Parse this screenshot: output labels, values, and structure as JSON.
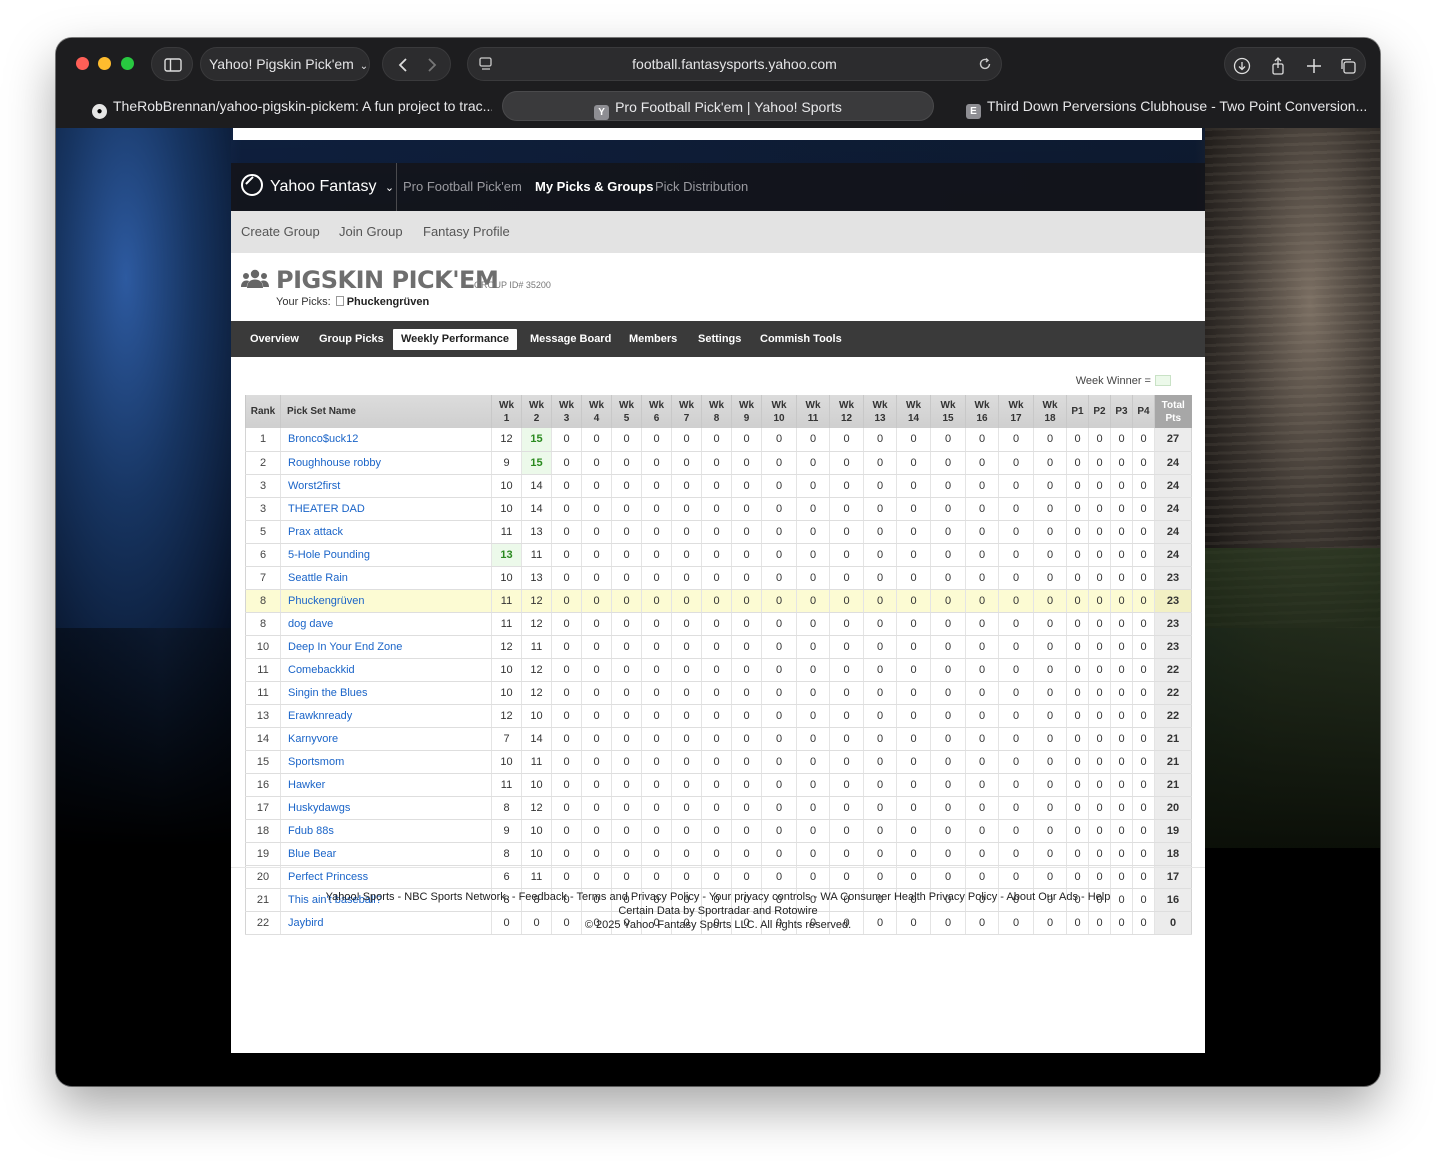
{
  "browser": {
    "tab_group": "Yahoo! Pigskin Pick'em",
    "address": "football.fantasysports.yahoo.com",
    "tabs": [
      {
        "title": "TheRobBrennan/yahoo-pigskin-pickem: A fun project to trac...",
        "icon": "github-icon"
      },
      {
        "title": "Pro Football Pick'em | Yahoo! Sports",
        "icon": "Y"
      },
      {
        "title": "Third Down Perversions Clubhouse - Two Point Conversion...",
        "icon": "E"
      }
    ]
  },
  "site": {
    "brand": "Yahoo Fantasy",
    "nav": [
      "Pro Football Pick'em",
      "My Picks & Groups",
      "Pick Distribution"
    ],
    "subnav": [
      "Create Group",
      "Join Group",
      "Fantasy Profile"
    ]
  },
  "group": {
    "title": "PIGSKIN PICK'EM",
    "group_id": "GROUP ID# 35200",
    "your_picks_label": "Your Picks:",
    "your_picks_name": "Phuckengrüven",
    "tabs": [
      "Overview",
      "Group Picks",
      "Weekly Performance",
      "Message Board",
      "Members",
      "Settings",
      "Commish Tools"
    ],
    "active_tab": "Weekly Performance",
    "week_winner_label": "Week Winner ="
  },
  "table": {
    "headers": {
      "rank": "Rank",
      "name": "Pick Set Name",
      "weeks": [
        "Wk\n1",
        "Wk\n2",
        "Wk\n3",
        "Wk\n4",
        "Wk\n5",
        "Wk\n6",
        "Wk\n7",
        "Wk\n8",
        "Wk\n9",
        "Wk\n10",
        "Wk\n11",
        "Wk\n12",
        "Wk\n13",
        "Wk\n14",
        "Wk\n15",
        "Wk\n16",
        "Wk\n17",
        "Wk\n18"
      ],
      "playoffs": [
        "P1",
        "P2",
        "P3",
        "P4"
      ],
      "total": "Total\nPts"
    },
    "rows": [
      {
        "rank": "1",
        "name": "Bronco$uck12",
        "wk1": "12",
        "wk2": "15",
        "total": "27",
        "win": [
          2
        ]
      },
      {
        "rank": "2",
        "name": "Roughhouse robby",
        "wk1": "9",
        "wk2": "15",
        "total": "24",
        "win": [
          2
        ]
      },
      {
        "rank": "3",
        "name": "Worst2first",
        "wk1": "10",
        "wk2": "14",
        "total": "24",
        "win": []
      },
      {
        "rank": "3",
        "name": "THEATER DAD",
        "wk1": "10",
        "wk2": "14",
        "total": "24",
        "win": []
      },
      {
        "rank": "5",
        "name": "Prax attack",
        "wk1": "11",
        "wk2": "13",
        "total": "24",
        "win": []
      },
      {
        "rank": "6",
        "name": "5-Hole Pounding",
        "wk1": "13",
        "wk2": "11",
        "total": "24",
        "win": [
          1
        ]
      },
      {
        "rank": "7",
        "name": "Seattle Rain",
        "wk1": "10",
        "wk2": "13",
        "total": "23",
        "win": []
      },
      {
        "rank": "8",
        "name": "Phuckengrüven",
        "wk1": "11",
        "wk2": "12",
        "total": "23",
        "win": [],
        "mine": true
      },
      {
        "rank": "8",
        "name": "dog dave",
        "wk1": "11",
        "wk2": "12",
        "total": "23",
        "win": []
      },
      {
        "rank": "10",
        "name": "Deep In Your End Zone",
        "wk1": "12",
        "wk2": "11",
        "total": "23",
        "win": []
      },
      {
        "rank": "11",
        "name": "Comebackkid",
        "wk1": "10",
        "wk2": "12",
        "total": "22",
        "win": []
      },
      {
        "rank": "11",
        "name": "Singin the Blues",
        "wk1": "10",
        "wk2": "12",
        "total": "22",
        "win": []
      },
      {
        "rank": "13",
        "name": "Erawknready",
        "wk1": "12",
        "wk2": "10",
        "total": "22",
        "win": []
      },
      {
        "rank": "14",
        "name": "Karnyvore",
        "wk1": "7",
        "wk2": "14",
        "total": "21",
        "win": []
      },
      {
        "rank": "15",
        "name": "Sportsmom",
        "wk1": "10",
        "wk2": "11",
        "total": "21",
        "win": []
      },
      {
        "rank": "16",
        "name": "Hawker",
        "wk1": "11",
        "wk2": "10",
        "total": "21",
        "win": []
      },
      {
        "rank": "17",
        "name": "Huskydawgs",
        "wk1": "8",
        "wk2": "12",
        "total": "20",
        "win": []
      },
      {
        "rank": "18",
        "name": "Fdub 88s",
        "wk1": "9",
        "wk2": "10",
        "total": "19",
        "win": []
      },
      {
        "rank": "19",
        "name": "Blue Bear",
        "wk1": "8",
        "wk2": "10",
        "total": "18",
        "win": []
      },
      {
        "rank": "20",
        "name": "Perfect Princess",
        "wk1": "6",
        "wk2": "11",
        "total": "17",
        "win": []
      },
      {
        "rank": "21",
        "name": "This ain't baseball?",
        "wk1": "8",
        "wk2": "8",
        "total": "16",
        "win": []
      },
      {
        "rank": "22",
        "name": "Jaybird",
        "wk1": "0",
        "wk2": "0",
        "total": "0",
        "win": []
      }
    ],
    "other_week_value": "0"
  },
  "footer": {
    "line1": "Yahoo! Sports - NBC Sports Network. - Feedback - Terms and Privacy Policy - Your privacy controls - WA Consumer Health Privacy Policy  - About Our Ads - Help",
    "line2": "Certain Data by Sportradar and Rotowire",
    "line3": "© 2025 Yahoo Fantasy Sports LLC. All rights reserved."
  },
  "colors": {
    "link": "#1a64c8",
    "winner_bg": "#ecf9ea",
    "winner_text": "#2a8a1f",
    "mine_bg": "#fcfbd3"
  }
}
